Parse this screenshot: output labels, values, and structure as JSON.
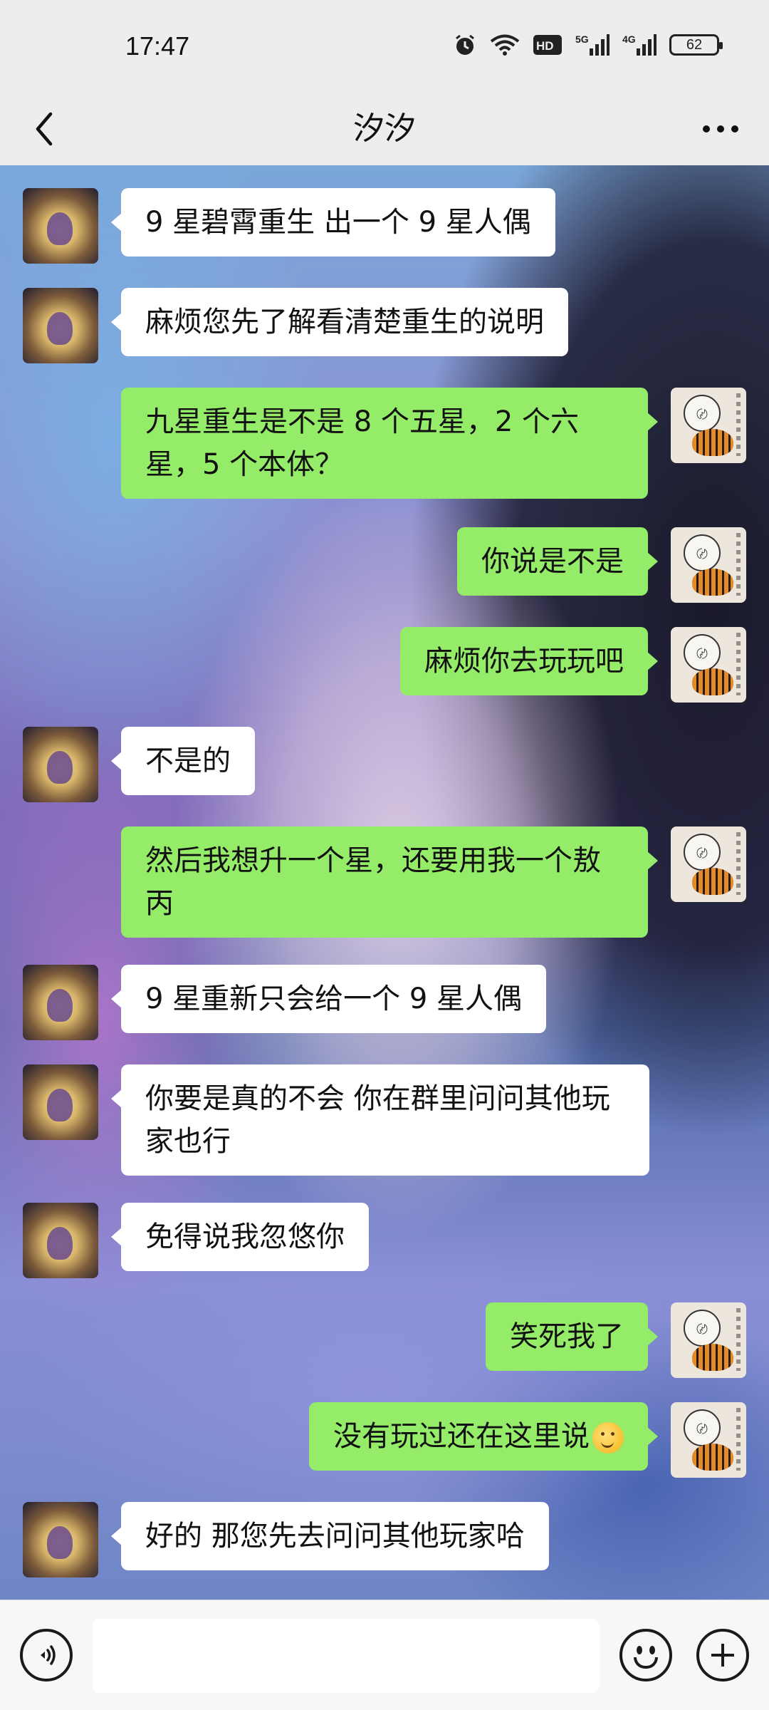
{
  "status_bar": {
    "time": "17:47",
    "battery_level": "62",
    "network_labels": [
      "HD",
      "5G",
      "4G"
    ],
    "icons": [
      "alarm-icon",
      "wifi-icon",
      "hd-icon",
      "signal-5g-icon",
      "signal-4g-icon",
      "battery-icon"
    ]
  },
  "nav": {
    "title": "汐汐",
    "back_icon": "chevron-left-icon",
    "more_icon": "more-dots-icon"
  },
  "colors": {
    "self_bubble": "#95ec69",
    "other_bubble": "#ffffff",
    "chrome": "#ededed"
  },
  "messages": [
    {
      "sender": "other",
      "text": "9 星碧霄重生 出一个 9 星人偶"
    },
    {
      "sender": "other",
      "text": "麻烦您先了解看清楚重生的说明"
    },
    {
      "sender": "self",
      "text": "九星重生是不是 8 个五星，2 个六星，5 个本体？"
    },
    {
      "sender": "self",
      "text": "你说是不是"
    },
    {
      "sender": "self",
      "text": "麻烦你去玩玩吧"
    },
    {
      "sender": "other",
      "text": "不是的"
    },
    {
      "sender": "self",
      "text": "然后我想升一个星，还要用我一个敖丙"
    },
    {
      "sender": "other",
      "text": "9 星重新只会给一个 9 星人偶"
    },
    {
      "sender": "other",
      "text": "你要是真的不会  你在群里问问其他玩家也行"
    },
    {
      "sender": "other",
      "text": "免得说我忽悠你"
    },
    {
      "sender": "self",
      "text": "笑死我了"
    },
    {
      "sender": "self",
      "text": "没有玩过还在这里说",
      "emoji": "thinking-face-emoji"
    },
    {
      "sender": "other",
      "text": "好的  那您先去问问其他玩家哈"
    }
  ],
  "input_bar": {
    "voice_icon": "voice-icon",
    "input_value": "",
    "emoji_icon": "emoji-icon",
    "plus_icon": "plus-icon"
  }
}
